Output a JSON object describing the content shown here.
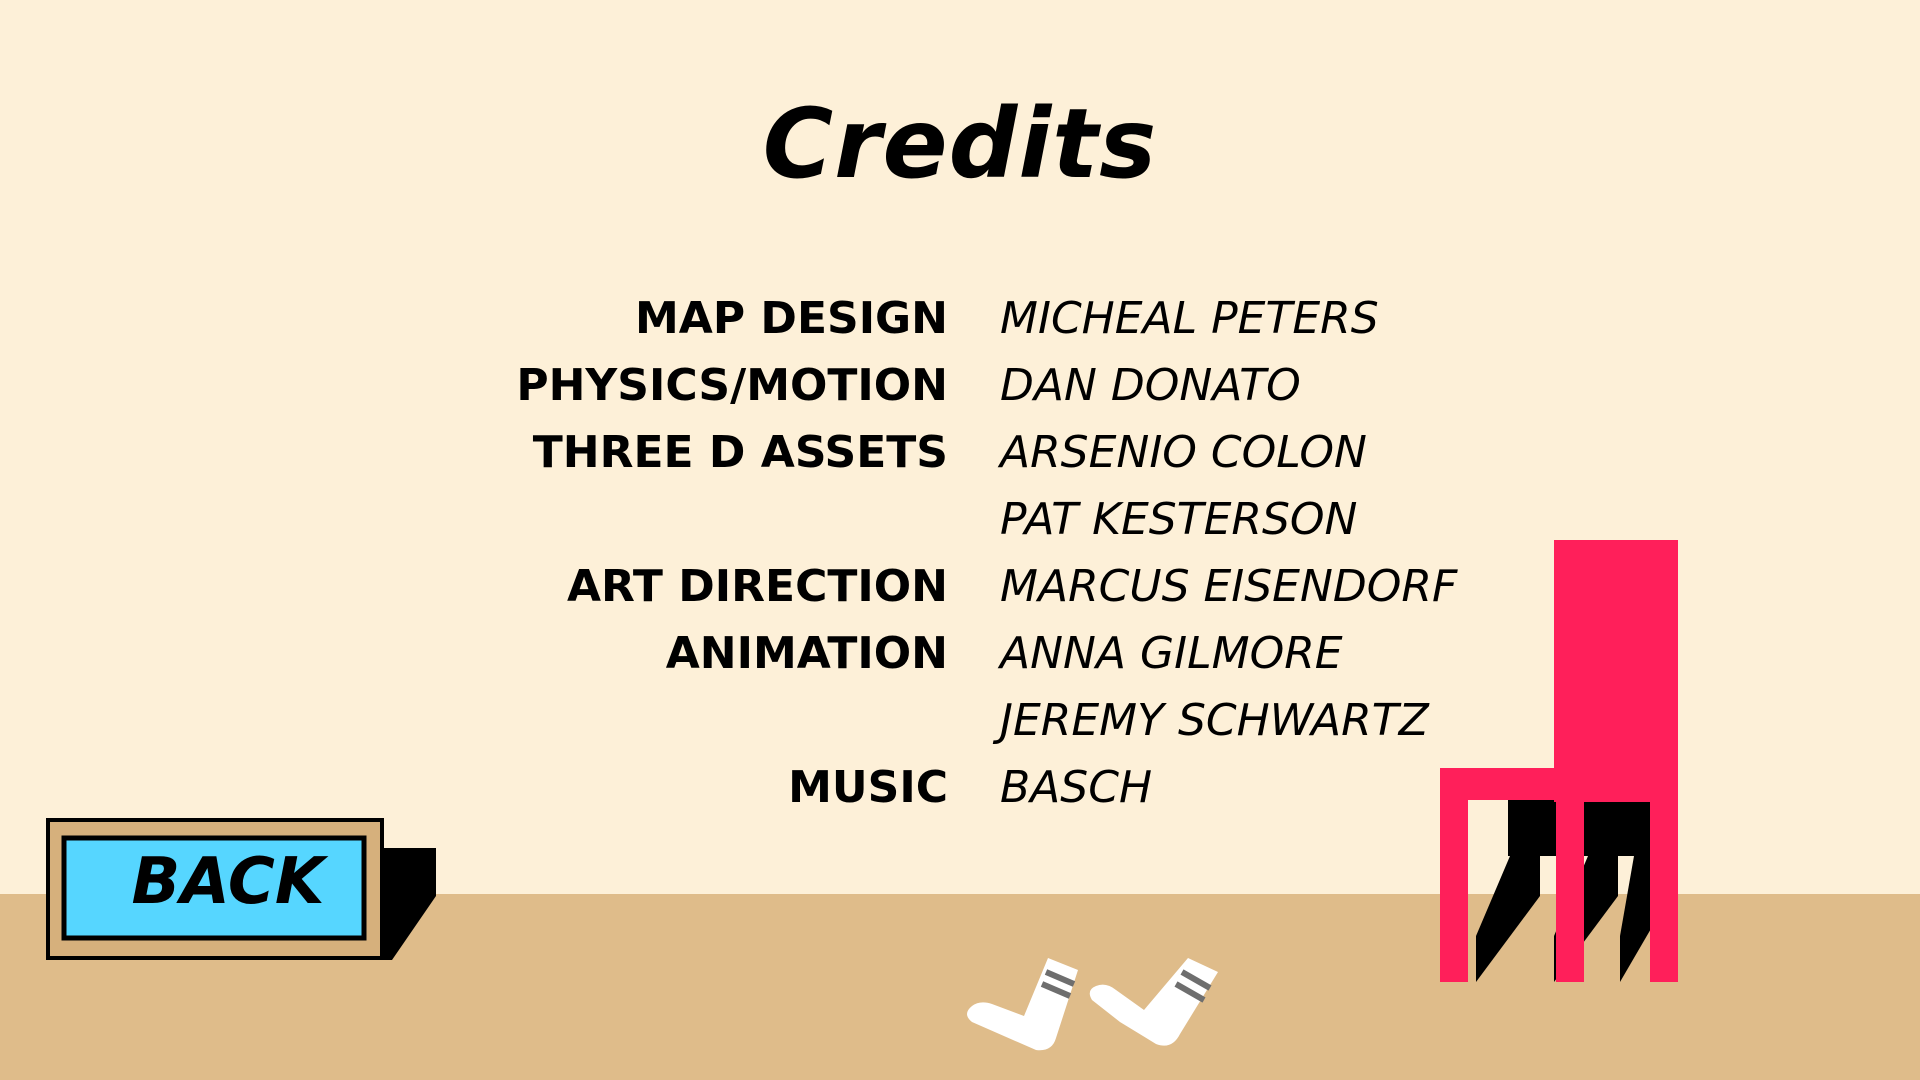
{
  "title": "Credits",
  "credits": [
    {
      "role": "MAP DESIGN",
      "name": "MICHEAL PETERS"
    },
    {
      "role": "PHYSICS/MOTION",
      "name": "DAN DONATO"
    },
    {
      "role": "THREE D ASSETS",
      "name": "ARSENIO COLON"
    },
    {
      "role": "",
      "name": "PAT KESTERSON"
    },
    {
      "role": "ART DIRECTION",
      "name": "MARCUS EISENDORF"
    },
    {
      "role": "ANIMATION",
      "name": "ANNA GILMORE"
    },
    {
      "role": "",
      "name": "JEREMY SCHWARTZ"
    },
    {
      "role": "MUSIC",
      "name": "BASCH"
    }
  ],
  "back_button": {
    "label": "BACK"
  },
  "colors": {
    "background": "#fdf0d8",
    "floor": "#dfbc8a",
    "button_fill": "#56d6ff",
    "button_frame": "#d6b07c",
    "chair": "#ff1f5a"
  },
  "decor": {
    "chair_icon": "red-chair-icon",
    "socks_icon": "white-socks-icon"
  }
}
